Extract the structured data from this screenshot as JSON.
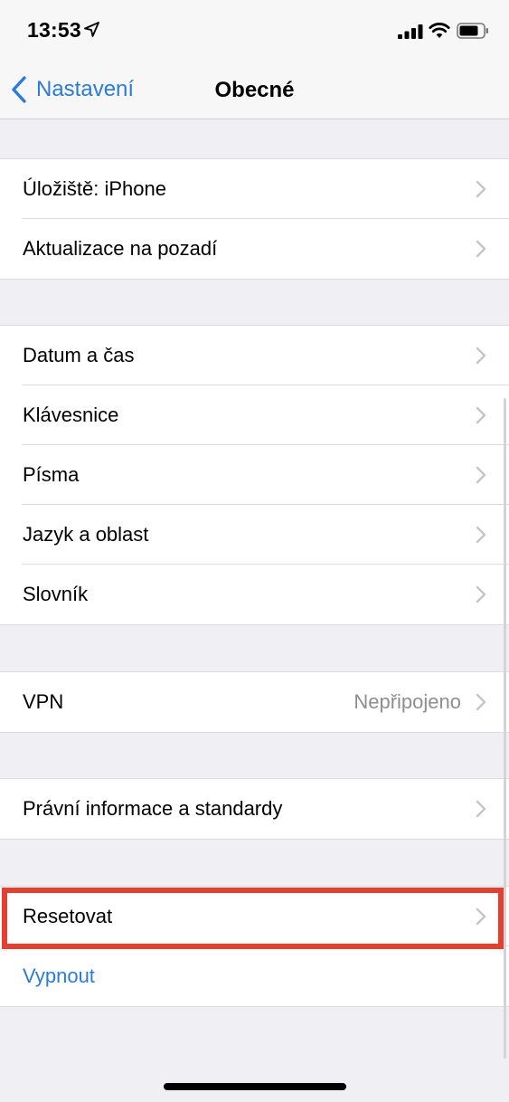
{
  "status_bar": {
    "time": "13:53",
    "icons": [
      "location-arrow-icon",
      "cellular-signal-icon",
      "wifi-icon",
      "battery-icon"
    ]
  },
  "nav": {
    "back_label": "Nastavení",
    "title": "Obecné"
  },
  "groups": [
    {
      "rows": [
        {
          "label": "Úložiště: iPhone"
        },
        {
          "label": "Aktualizace na pozadí"
        }
      ]
    },
    {
      "rows": [
        {
          "label": "Datum a čas"
        },
        {
          "label": "Klávesnice"
        },
        {
          "label": "Písma"
        },
        {
          "label": "Jazyk a oblast"
        },
        {
          "label": "Slovník"
        }
      ]
    },
    {
      "rows": [
        {
          "label": "VPN",
          "value": "Nepřipojeno"
        }
      ]
    },
    {
      "rows": [
        {
          "label": "Právní informace a standardy"
        }
      ]
    },
    {
      "rows": [
        {
          "label": "Resetovat"
        },
        {
          "label": "Vypnout"
        }
      ]
    }
  ],
  "colors": {
    "accent": "#2b7bd9",
    "highlight_box": "#e5402f",
    "background": "#efeff4"
  }
}
